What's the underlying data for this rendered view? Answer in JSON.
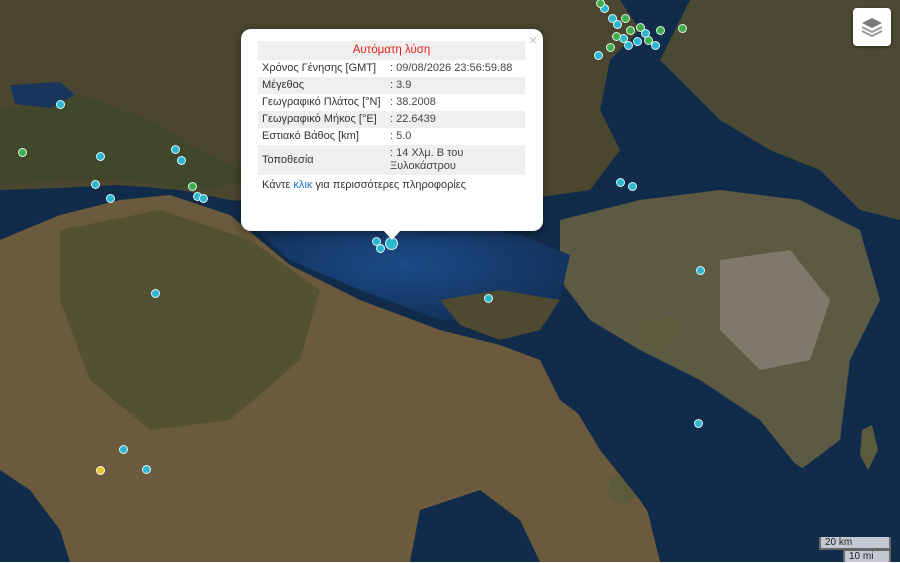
{
  "map": {
    "colors": {
      "sea": "#0f2a4a",
      "sea_gulf": "#163a6a",
      "land_green": "#3e4a2a",
      "land_brown": "#6d5a3c",
      "urban": "#8a8478"
    }
  },
  "markers": [
    {
      "color": "#2cb8d2",
      "size": "small"
    },
    {
      "color": "#2cb8d2",
      "size": "small"
    },
    {
      "color": "#2cb8d2",
      "size": "small"
    },
    {
      "color": "#2cb8d2",
      "size": "small"
    },
    {
      "color": "#2cb8d2",
      "size": "small"
    },
    {
      "color": "#2cb8d2",
      "size": "small"
    },
    {
      "color": "#2cb8d2",
      "size": "small"
    },
    {
      "color": "#2cb8d2",
      "size": "small"
    },
    {
      "color": "#2cb8d2",
      "size": "small"
    },
    {
      "color": "#2cb8d2",
      "size": "small"
    },
    {
      "color": "#2cb8d2",
      "size": "small"
    },
    {
      "color": "#2cb8d2",
      "size": "small"
    },
    {
      "color": "#2cb8d2",
      "size": "small"
    },
    {
      "color": "#2cb8d2",
      "size": "small"
    },
    {
      "color": "#2cb8d2",
      "size": "small"
    },
    {
      "color": "#2cb8d2",
      "size": "small"
    },
    {
      "color": "#2cb8d2",
      "size": "small"
    },
    {
      "color": "#2cb8d2",
      "size": "small"
    },
    {
      "color": "#2cb8d2",
      "size": "small"
    },
    {
      "color": "#2cb8d2",
      "size": "small"
    },
    {
      "color": "#2cb8d2",
      "size": "small"
    },
    {
      "color": "#2cb8d2",
      "size": "small"
    },
    {
      "color": "#2cb8d2",
      "size": "small"
    },
    {
      "color": "#2cb8d2",
      "size": "small"
    },
    {
      "color": "#2cb8d2",
      "size": "small"
    },
    {
      "color": "#2cb8d2",
      "size": "small"
    },
    {
      "color": "#2cb8d2",
      "size": "small"
    },
    {
      "color": "#3fae4c",
      "size": "small"
    },
    {
      "color": "#3fae4c",
      "size": "small"
    },
    {
      "color": "#3fae4c",
      "size": "small"
    },
    {
      "color": "#3fae4c",
      "size": "small"
    },
    {
      "color": "#3fae4c",
      "size": "small"
    },
    {
      "color": "#3fae4c",
      "size": "small"
    },
    {
      "color": "#3fae4c",
      "size": "small"
    },
    {
      "color": "#3fae4c",
      "size": "small"
    },
    {
      "color": "#3fae4c",
      "size": "small"
    },
    {
      "color": "#3fae4c",
      "size": "small"
    },
    {
      "color": "#3fae4c",
      "size": "small"
    },
    {
      "color": "#e8c631",
      "size": "small"
    },
    {
      "color": "#2cb8d2",
      "size": "large"
    }
  ],
  "popup": {
    "title": "Αυτόματη λύση",
    "close": "×",
    "rows": [
      {
        "label": "Χρόνος Γένησης [GMT]",
        "value": ": 09/08/2026 23:56:59.88"
      },
      {
        "label": "Μέγεθος",
        "value": ": 3.9"
      },
      {
        "label": "Γεωγραφικό Πλάτος [°N]",
        "value": ": 38.2008"
      },
      {
        "label": "Γεωγραφικό Μήκος [°E]",
        "value": ": 22.6439"
      },
      {
        "label": "Εστιακό Βάθος [km]",
        "value": ": 5.0"
      },
      {
        "label": "Τοποθεσία",
        "value": ": 14 Χλμ. Β του Ξυλοκάστρου"
      }
    ],
    "footer_pre": "Κάντε ",
    "footer_link": "κλικ",
    "footer_post": " για περισσότερες πληροφορίες"
  },
  "scale": {
    "km": "20 km",
    "mi": "10 mi"
  }
}
